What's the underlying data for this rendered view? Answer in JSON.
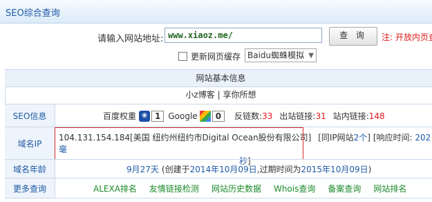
{
  "title": "SEO综合查询",
  "search": {
    "label": "请输入网站地址:",
    "value": "www.xiaoz.me/",
    "button": "查 询",
    "note": "注: 开放内页查"
  },
  "options": {
    "cache_label": "更新网页缓存",
    "engine_selected": "Baidu蜘蛛模拟"
  },
  "section_title": "网站基本信息",
  "site_name": "小z博客 | 享你所想",
  "seo": {
    "label": "SEO信息",
    "baidu_label": "百度权重",
    "baidu_value": "1",
    "google_label": "Google",
    "google_value": "0",
    "backlinks_label": "反链数:",
    "backlinks_value": "33",
    "outlinks_label": "出站链接:",
    "outlinks_value": "31",
    "inlinks_label": "站内链接:",
    "inlinks_value": "148"
  },
  "domain_ip": {
    "label": "域名IP",
    "line1": "104.131.154.184[美国 纽约州纽约市Digital Ocean股份有限公司]",
    "same_ip_prefix": "[同IP网站",
    "same_ip_count": "2个",
    "same_ip_suffix": "]",
    "resp_prefix": "[响应时间:",
    "resp_value": "202毫",
    "line2_value": "秒",
    "line2_suffix": "]"
  },
  "domain_age": {
    "label": "域名年龄",
    "age": "9月27天",
    "created_prefix": "(创建于",
    "created": "2014年10月09日",
    "expire_prefix": ",过期时间为",
    "expire": "2015年10月09日",
    "suffix": ")"
  },
  "more": {
    "label": "更多查询",
    "links": [
      "ALEXA排名",
      "友情链接检测",
      "网站历史数据",
      "Whois查询",
      "备案查询",
      "网站排名"
    ]
  }
}
